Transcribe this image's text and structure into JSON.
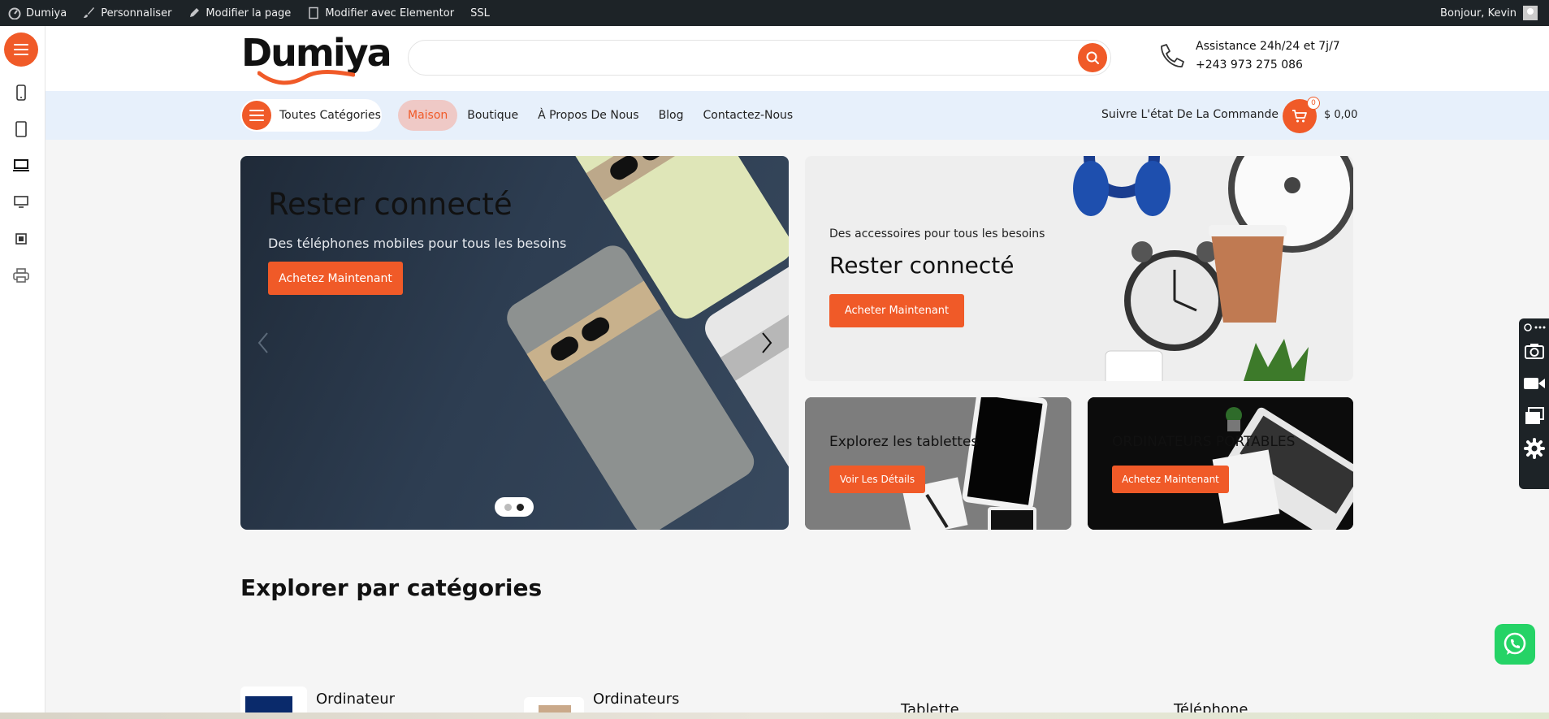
{
  "adminbar": {
    "site": "Dumiya",
    "customize": "Personnaliser",
    "edit_page": "Modifier la page",
    "elementor": "Modifier avec Elementor",
    "ssl": "SSL",
    "greeting": "Bonjour, Kevin"
  },
  "header": {
    "logo": "Dumiya",
    "search_placeholder": "",
    "support_line1": "Assistance 24h/24 et 7j/7",
    "support_line2": "+243 973 275 086"
  },
  "nav": {
    "categories": "Toutes Catégories",
    "items": [
      "Maison",
      "Boutique",
      "À Propos De Nous",
      "Blog",
      "Contactez-Nous"
    ],
    "active_index": 0,
    "track": "Suivre L'état De La Commande",
    "cart_count": "0",
    "cart_total": "$ 0,00"
  },
  "hero": {
    "title": "Rester connecté",
    "subtitle": "Des téléphones mobiles pour tous les besoins",
    "cta": "Achetez Maintenant"
  },
  "cards": {
    "top_small": "Des accessoires pour tous les besoins",
    "top_title": "Rester connecté",
    "top_cta": "Acheter Maintenant",
    "tablet_title": "Explorez les tablettes",
    "tablet_cta": "Voir Les Détails",
    "laptop_title": "ORDINATEURS PORTABLES",
    "laptop_cta": "Achetez Maintenant"
  },
  "categories": {
    "title": "Explorer par catégories",
    "items": [
      "Ordinateur",
      "Ordinateurs",
      "Tablette",
      "Téléphone"
    ]
  },
  "colors": {
    "accent": "#f05a28",
    "adminbar": "#1d2327",
    "navbar": "#e7f0fb",
    "whatsapp": "#25d366"
  }
}
